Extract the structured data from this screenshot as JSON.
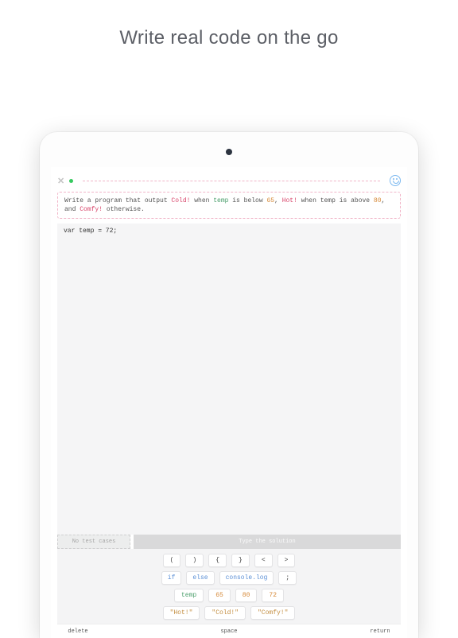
{
  "heading": "Write real code on the go",
  "prompt": {
    "text_before_cold": "Write a program that output ",
    "cold": "Cold!",
    "text_when": " when ",
    "temp": "temp",
    "text_below": " is below ",
    "n65": "65",
    "comma_sp": ", ",
    "hot": "Hot!",
    "text_above": " when temp is above ",
    "n80": "80",
    "and": ", and ",
    "comfy": "Comfy!",
    "otherwise": " otherwise."
  },
  "code": "var temp = 72;",
  "toolbar": {
    "no_tests": "No test cases",
    "type_solution": "Type the solution"
  },
  "keys": {
    "row1": [
      "(",
      ")",
      "{",
      "}",
      "<",
      ">"
    ],
    "row2": [
      "if",
      "else",
      "console.log",
      ";"
    ],
    "row3": [
      "temp",
      "65",
      "80",
      "72"
    ],
    "row4": [
      "\"Hot!\"",
      "\"Cold!\"",
      "\"Comfy!\""
    ]
  },
  "bottom": {
    "delete": "delete",
    "space": "space",
    "return": "return"
  }
}
